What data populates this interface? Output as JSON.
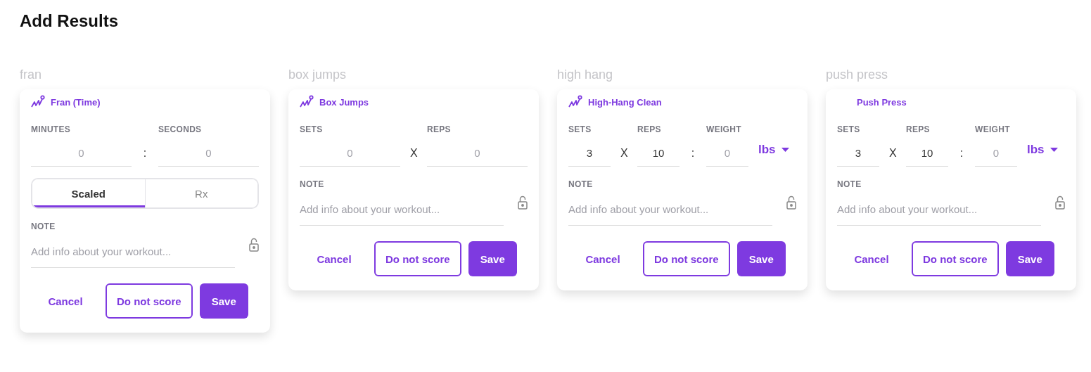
{
  "title": "Add Results",
  "workouts": [
    {
      "label": "fran",
      "name": "Fran (Time)",
      "icon": true,
      "fields": [
        {
          "label": "MINUTES",
          "placeholder": "0"
        },
        {
          "sep": ":",
          "label": "SECONDS",
          "placeholder": "0"
        }
      ],
      "toggle": [
        {
          "label": "Scaled",
          "selected": true
        },
        {
          "label": "Rx",
          "selected": false
        }
      ],
      "note": {
        "label": "NOTE",
        "placeholder": "Add info about your workout..."
      },
      "buttons": {
        "cancel": "Cancel",
        "skip": "Do not score",
        "save": "Save"
      }
    },
    {
      "label": "box jumps",
      "name": "Box Jumps",
      "icon": true,
      "fields": [
        {
          "label": "SETS",
          "placeholder": "0"
        },
        {
          "sep": "X",
          "label": "REPS",
          "placeholder": "0"
        }
      ],
      "note": {
        "label": "NOTE",
        "placeholder": "Add info about your workout..."
      },
      "buttons": {
        "cancel": "Cancel",
        "skip": "Do not score",
        "save": "Save"
      }
    },
    {
      "label": "high hang",
      "name": "High-Hang Clean",
      "icon": true,
      "fields": [
        {
          "label": "SETS",
          "value": "3"
        },
        {
          "sep": "X",
          "label": "REPS",
          "value": "10"
        },
        {
          "sep": ":",
          "label": "WEIGHT",
          "placeholder": "0"
        }
      ],
      "unit": "lbs",
      "note": {
        "label": "NOTE",
        "placeholder": "Add info about your workout..."
      },
      "buttons": {
        "cancel": "Cancel",
        "skip": "Do not score",
        "save": "Save"
      }
    },
    {
      "label": "push press",
      "name": "Push Press",
      "icon": false,
      "fields": [
        {
          "label": "SETS",
          "value": "3"
        },
        {
          "sep": "X",
          "label": "REPS",
          "value": "10"
        },
        {
          "sep": ":",
          "label": "WEIGHT",
          "placeholder": "0"
        }
      ],
      "unit": "lbs",
      "note": {
        "label": "NOTE",
        "placeholder": "Add info about your workout..."
      },
      "buttons": {
        "cancel": "Cancel",
        "skip": "Do not score",
        "save": "Save"
      }
    }
  ]
}
